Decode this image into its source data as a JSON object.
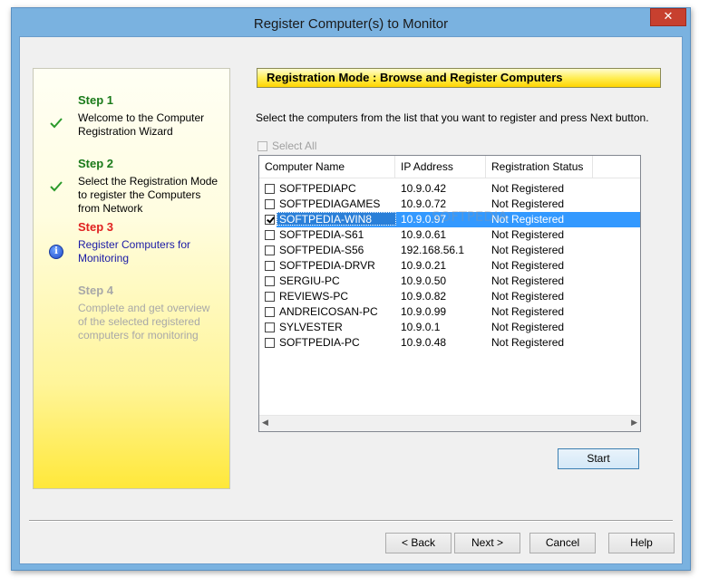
{
  "window": {
    "title": "Register Computer(s) to Monitor",
    "close_label": "✕"
  },
  "steps": [
    {
      "title": "Step 1",
      "desc": "Welcome to the Computer Registration Wizard",
      "state": "done"
    },
    {
      "title": "Step 2",
      "desc": "Select the Registration Mode to register the Computers from Network",
      "state": "done"
    },
    {
      "title": "Step 3",
      "desc": "Register Computers for Monitoring",
      "state": "current"
    },
    {
      "title": "Step 4",
      "desc": "Complete and get overview of the selected registered computers for monitoring",
      "state": "future"
    }
  ],
  "main": {
    "header": "Registration Mode : Browse and Register Computers",
    "instruction": "Select the computers from the list that you want to register and press Next button.",
    "select_all_label": "Select All",
    "columns": [
      "Computer Name",
      "IP Address",
      "Registration Status"
    ],
    "rows": [
      {
        "name": "SOFTPEDIAPC",
        "ip": "10.9.0.42",
        "status": "Not Registered",
        "checked": false
      },
      {
        "name": "SOFTPEDIAGAMES",
        "ip": "10.9.0.72",
        "status": "Not Registered",
        "checked": false
      },
      {
        "name": "SOFTPEDIA-WIN8",
        "ip": "10.9.0.97",
        "status": "Not Registered",
        "checked": true
      },
      {
        "name": "SOFTPEDIA-S61",
        "ip": "10.9.0.61",
        "status": "Not Registered",
        "checked": false
      },
      {
        "name": "SOFTPEDIA-S56",
        "ip": "192.168.56.1",
        "status": "Not Registered",
        "checked": false
      },
      {
        "name": "SOFTPEDIA-DRVR",
        "ip": "10.9.0.21",
        "status": "Not Registered",
        "checked": false
      },
      {
        "name": "SERGIU-PC",
        "ip": "10.9.0.50",
        "status": "Not Registered",
        "checked": false
      },
      {
        "name": "REVIEWS-PC",
        "ip": "10.9.0.82",
        "status": "Not Registered",
        "checked": false
      },
      {
        "name": "ANDREICOSAN-PC",
        "ip": "10.9.0.99",
        "status": "Not Registered",
        "checked": false
      },
      {
        "name": "SYLVESTER",
        "ip": "10.9.0.1",
        "status": "Not Registered",
        "checked": false
      },
      {
        "name": "SOFTPEDIA-PC",
        "ip": "10.9.0.48",
        "status": "Not Registered",
        "checked": false
      }
    ],
    "start_label": "Start"
  },
  "footer": {
    "back_label": "< Back",
    "next_label": "Next >",
    "cancel_label": "Cancel",
    "help_label": "Help"
  }
}
